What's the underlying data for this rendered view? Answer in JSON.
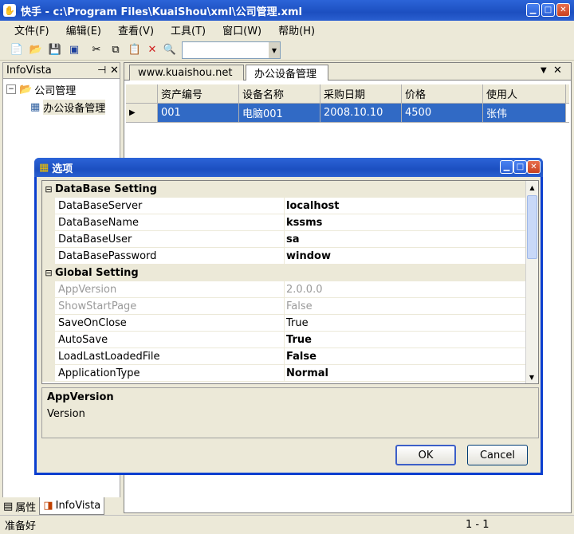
{
  "window": {
    "title": "快手 - c:\\Program Files\\KuaiShou\\xml\\公司管理.xml"
  },
  "menu": [
    "文件(F)",
    "编辑(E)",
    "查看(V)",
    "工具(T)",
    "窗口(W)",
    "帮助(H)"
  ],
  "left_panel": {
    "title": "InfoVista",
    "tree_root": "公司管理",
    "tree_child": "办公设备管理",
    "tabs": [
      "属性",
      "InfoVista"
    ]
  },
  "doc": {
    "tabs": [
      "www.kuaishou.net",
      "办公设备管理"
    ],
    "columns": [
      "资产编号",
      "设备名称",
      "采购日期",
      "价格",
      "使用人"
    ],
    "rows": [
      [
        "001",
        "电脑001",
        "2008.10.10",
        "4500",
        "张伟"
      ]
    ]
  },
  "dialog": {
    "title": "选项",
    "categories": [
      {
        "name": "DataBase Setting",
        "props": [
          {
            "k": "DataBaseServer",
            "v": "localhost"
          },
          {
            "k": "DataBaseName",
            "v": "kssms"
          },
          {
            "k": "DataBaseUser",
            "v": "sa"
          },
          {
            "k": "DataBasePassword",
            "v": "window"
          }
        ]
      },
      {
        "name": "Global Setting",
        "props": [
          {
            "k": "AppVersion",
            "v": "2.0.0.0"
          },
          {
            "k": "ShowStartPage",
            "v": "False"
          },
          {
            "k": "SaveOnClose",
            "v": "True"
          },
          {
            "k": "AutoSave",
            "v": "True"
          },
          {
            "k": "LoadLastLoadedFile",
            "v": "False"
          },
          {
            "k": "ApplicationType",
            "v": "Normal"
          }
        ]
      }
    ],
    "help_title": "AppVersion",
    "help_text": "Version",
    "ok": "OK",
    "cancel": "Cancel"
  },
  "status": {
    "left": "准备好",
    "right": "1 - 1"
  }
}
